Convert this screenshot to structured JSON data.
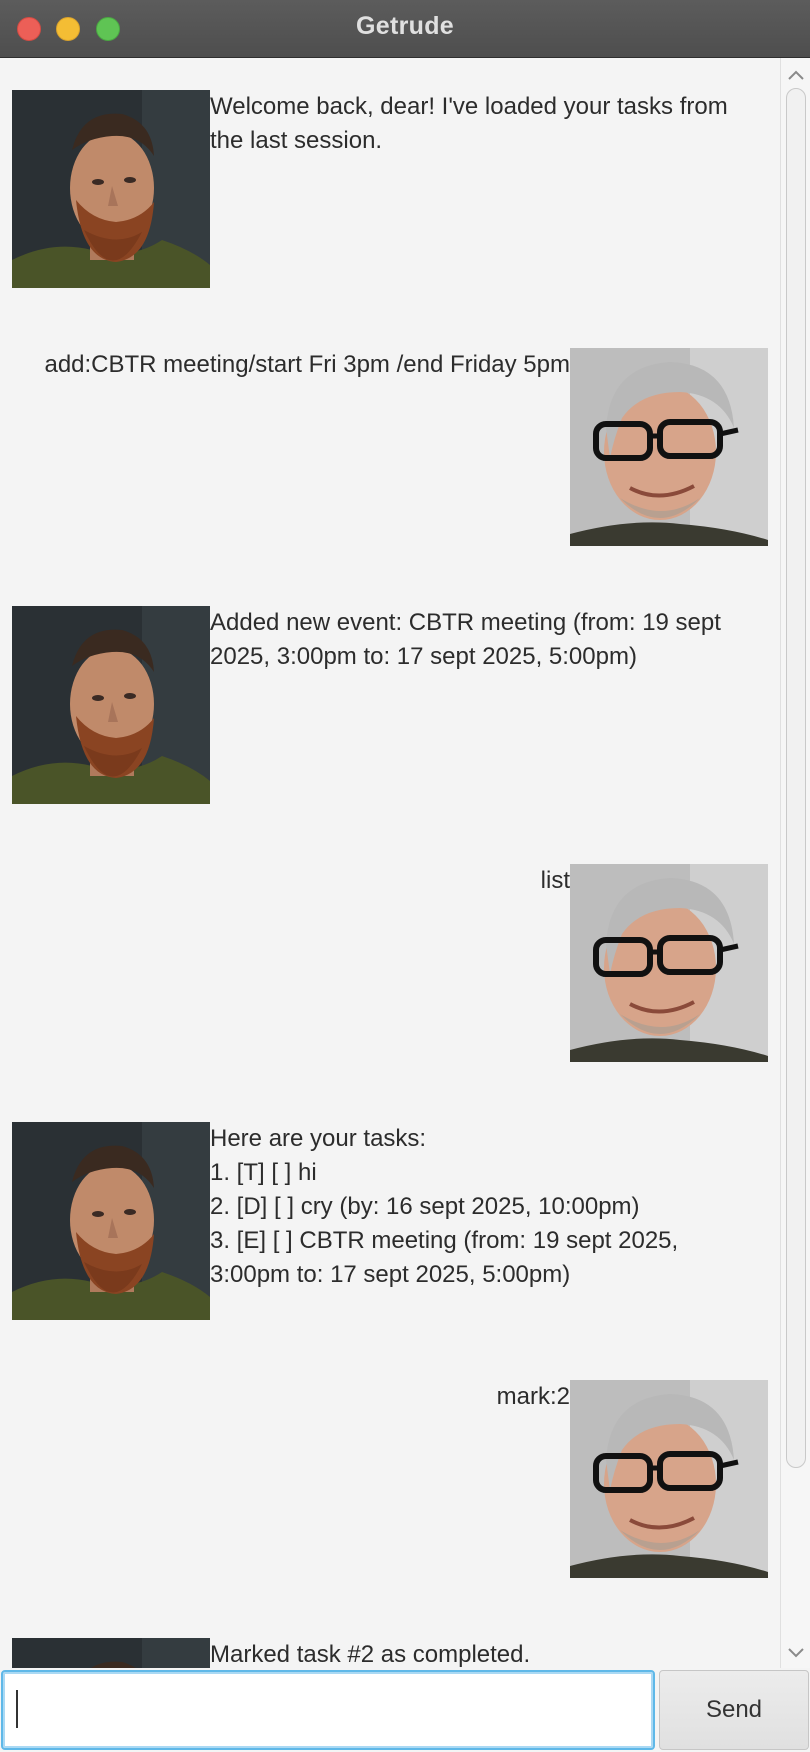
{
  "window": {
    "title": "Getrude"
  },
  "messages": [
    {
      "sender": "bot",
      "lines": [
        "Welcome back, dear! I've loaded your tasks from",
        "the last session."
      ]
    },
    {
      "sender": "user",
      "lines": [
        "add:CBTR meeting/start Fri 3pm /end Friday 5pm"
      ]
    },
    {
      "sender": "bot",
      "lines": [
        "Added new event: CBTR meeting (from: 19 sept",
        "2025, 3:00pm to: 17 sept 2025, 5:00pm)"
      ]
    },
    {
      "sender": "user",
      "lines": [
        "list"
      ]
    },
    {
      "sender": "bot",
      "lines": [
        "Here are your tasks:",
        "1. [T] [ ] hi",
        "2. [D] [ ] cry (by: 16 sept 2025, 10:00pm)",
        "3. [E] [ ] CBTR meeting (from: 19 sept 2025,",
        "3:00pm to: 17 sept 2025, 5:00pm)"
      ]
    },
    {
      "sender": "user",
      "lines": [
        "mark:2"
      ]
    },
    {
      "sender": "bot",
      "lines": [
        "Marked task #2 as completed."
      ]
    }
  ],
  "input": {
    "value": "",
    "placeholder": ""
  },
  "send_button": {
    "label": "Send"
  },
  "icons": {
    "bot_avatar": "bearded-man-avatar",
    "user_avatar": "man-with-glasses-avatar",
    "scroll_up": "chevron-up-icon",
    "scroll_down": "chevron-down-icon"
  },
  "colors": {
    "titlebar": "#555555",
    "close": "#ec5f57",
    "minimize": "#f4bd34",
    "maximize": "#5fc454",
    "input_focus": "#5fb8e8",
    "background": "#f4f4f4"
  }
}
